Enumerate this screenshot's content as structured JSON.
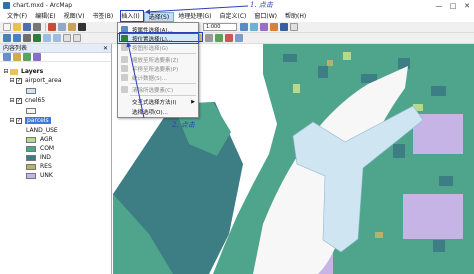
{
  "window": {
    "title": "chart.mxd - ArcMap",
    "controls": [
      "—",
      "□",
      "✕"
    ]
  },
  "menubar": {
    "items": [
      {
        "label": "文件(F)",
        "active": false
      },
      {
        "label": "编辑(E)",
        "active": false
      },
      {
        "label": "视图(V)",
        "active": false
      },
      {
        "label": "书签(B)",
        "active": false
      },
      {
        "label": "插入(I)",
        "active": false
      },
      {
        "label": "选择(S)",
        "active": true
      },
      {
        "label": "地理处理(G)",
        "active": false
      },
      {
        "label": "自定义(C)",
        "active": false
      },
      {
        "label": "窗口(W)",
        "active": false
      },
      {
        "label": "帮助(H)",
        "active": false
      }
    ]
  },
  "toolbar": {
    "scale": "1:000"
  },
  "toc": {
    "title": "内容列表",
    "root": "Layers",
    "layers": [
      {
        "name": "airport_area",
        "checked": true
      },
      {
        "name": "cnel65",
        "checked": true
      },
      {
        "name": "parcels",
        "checked": true,
        "selected": true
      }
    ],
    "legend_field": "LAND_USE",
    "legend": [
      {
        "label": "AGR",
        "color": "#b7d98b"
      },
      {
        "label": "COM",
        "color": "#4fa58c"
      },
      {
        "label": "IND",
        "color": "#3d7d84"
      },
      {
        "label": "RES",
        "color": "#b8b06c"
      },
      {
        "label": "UNK",
        "color": "#c6b4e6"
      }
    ]
  },
  "selection_menu": {
    "items": [
      {
        "label": "按属性选择(A)...",
        "icon": "attribute-select-icon",
        "disabled": false,
        "hover": false
      },
      {
        "label": "按位置选择(L)...",
        "icon": "location-select-icon",
        "disabled": false,
        "hover": true
      },
      {
        "label": "按图形选择(G)",
        "icon": "graphic-select-icon",
        "disabled": true,
        "hover": false
      },
      {
        "label": "缩放至所选要素(Z)",
        "icon": "zoom-selected-icon",
        "disabled": true,
        "hover": false
      },
      {
        "label": "平移至所选要素(P)",
        "icon": "pan-selected-icon",
        "disabled": true,
        "hover": false
      },
      {
        "label": "统计数据(S)...",
        "icon": "statistics-icon",
        "disabled": true,
        "hover": false
      },
      {
        "label": "清除所选要素(C)",
        "icon": "clear-selection-icon",
        "disabled": true,
        "hover": false
      },
      {
        "label": "交互式选择方法(I)",
        "icon": "",
        "disabled": false,
        "hover": false,
        "submenu": true
      },
      {
        "label": "选择选项(O)...",
        "icon": "",
        "disabled": false,
        "hover": false
      }
    ]
  },
  "annotations": {
    "step1": "1. 点击",
    "step2": "2. 点击"
  },
  "colors": {
    "accent": "#2b3fb8",
    "menu_hover": "#d6e6fa",
    "parcel_dark": "#3d7d84",
    "parcel_green": "#4fa58c",
    "airport": "#cfe6f2"
  }
}
